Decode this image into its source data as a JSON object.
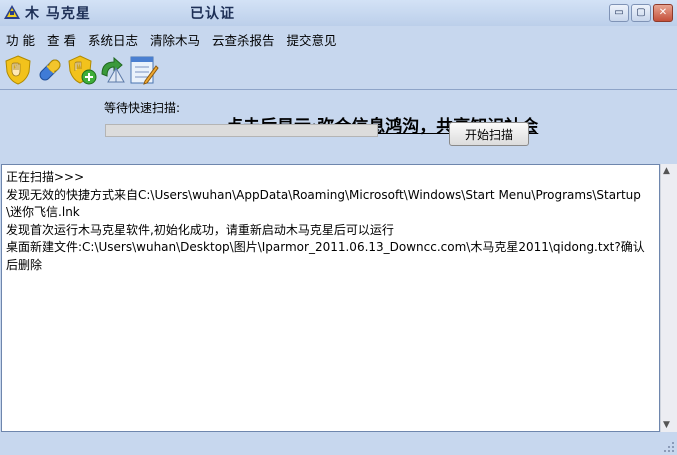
{
  "window": {
    "title": "木 马克星",
    "certified": "已认证",
    "buttons": {
      "minimize": "▭",
      "restore": "▢",
      "close": "✕"
    }
  },
  "menu": [
    "功 能",
    "查 看",
    "系统日志",
    "清除木马",
    "云查杀报告",
    "提交意见"
  ],
  "toolbar": {
    "icons": [
      "shield-scan-icon",
      "capsule-icon",
      "shield-add-icon",
      "update-icon",
      "notepad-icon"
    ],
    "banner": "点击后显示:弥合信息鸿沟，共享知识社会"
  },
  "scan": {
    "label": "等待快速扫描:",
    "progress": 0,
    "start_label": "开始扫描"
  },
  "log": [
    "正在扫描>>>",
    "发现无效的快捷方式来自C:\\Users\\wuhan\\AppData\\Roaming\\Microsoft\\Windows\\Start Menu\\Programs\\Startup\\迷你飞信.lnk",
    "发现首次运行木马克星软件,初始化成功，请重新启动木马克星后可以运行",
    "桌面新建文件:C:\\Users\\wuhan\\Desktop\\图片\\Iparmor_2011.06.13_Downcc.com\\木马克星2011\\qidong.txt?确认后删除"
  ],
  "colors": {
    "window_bg": "#c7d7ee",
    "title_text": "#1d2f56"
  }
}
